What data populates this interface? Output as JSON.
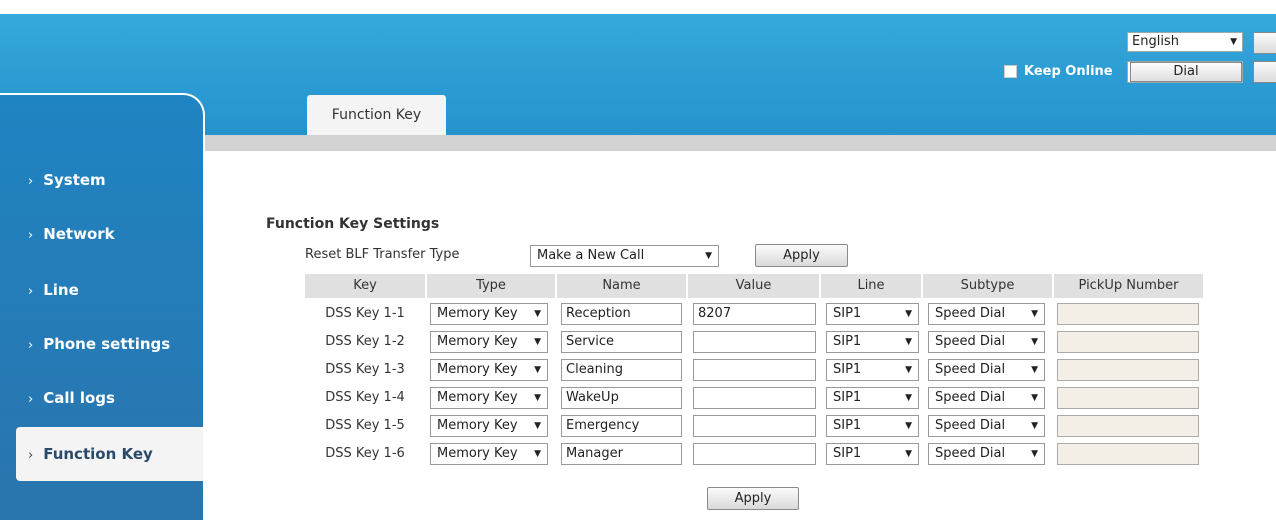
{
  "header": {
    "language": "English",
    "keep_online_label": "Keep Online",
    "dial_label": "Dial"
  },
  "tab": {
    "label": "Function Key"
  },
  "sidebar": {
    "items": [
      {
        "label": "System"
      },
      {
        "label": "Network"
      },
      {
        "label": "Line"
      },
      {
        "label": "Phone settings"
      },
      {
        "label": "Call logs"
      },
      {
        "label": "Function Key",
        "active": true
      }
    ]
  },
  "content": {
    "section_title": "Function Key Settings",
    "reset_label": "Reset BLF Transfer Type",
    "reset_value": "Make a New Call",
    "apply_label": "Apply",
    "bottom_apply_label": "Apply",
    "columns": [
      "Key",
      "Type",
      "Name",
      "Value",
      "Line",
      "Subtype",
      "PickUp Number"
    ],
    "rows": [
      {
        "key": "DSS Key 1-1",
        "type": "Memory Key",
        "name": "Reception",
        "value": "8207",
        "line": "SIP1",
        "subtype": "Speed Dial",
        "pickup": ""
      },
      {
        "key": "DSS Key 1-2",
        "type": "Memory Key",
        "name": "Service",
        "value": "",
        "line": "SIP1",
        "subtype": "Speed Dial",
        "pickup": ""
      },
      {
        "key": "DSS Key 1-3",
        "type": "Memory Key",
        "name": "Cleaning",
        "value": "",
        "line": "SIP1",
        "subtype": "Speed Dial",
        "pickup": ""
      },
      {
        "key": "DSS Key 1-4",
        "type": "Memory Key",
        "name": "WakeUp",
        "value": "",
        "line": "SIP1",
        "subtype": "Speed Dial",
        "pickup": ""
      },
      {
        "key": "DSS Key 1-5",
        "type": "Memory Key",
        "name": "Emergency",
        "value": "",
        "line": "SIP1",
        "subtype": "Speed Dial",
        "pickup": ""
      },
      {
        "key": "DSS Key 1-6",
        "type": "Memory Key",
        "name": "Manager",
        "value": "",
        "line": "SIP1",
        "subtype": "Speed Dial",
        "pickup": ""
      }
    ]
  },
  "colors": {
    "header_blue": "#2b9bd3",
    "sidebar_blue": "#2a74ad",
    "table_header_gray": "#e0e0e0",
    "disabled_field": "#f3efe6"
  }
}
